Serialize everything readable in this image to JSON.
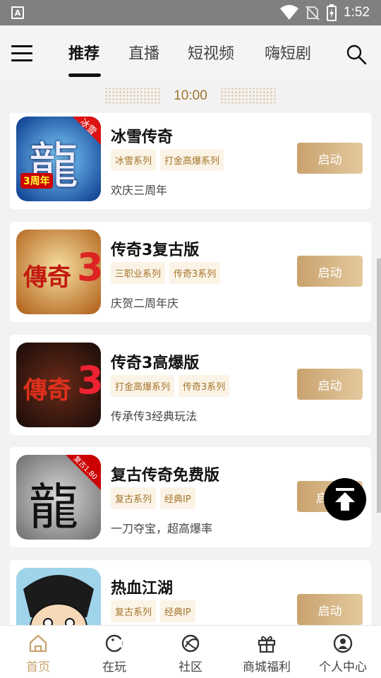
{
  "status_bar": {
    "time": "1:52",
    "app_badge": "A"
  },
  "nav": {
    "tabs": [
      {
        "label": "推荐",
        "active": true
      },
      {
        "label": "直播",
        "active": false
      },
      {
        "label": "短视频",
        "active": false
      },
      {
        "label": "嗨短剧",
        "active": false
      }
    ]
  },
  "countdown": {
    "time": "10:00"
  },
  "games": [
    {
      "title": "冰雪传奇",
      "tags": [
        "冰雪系列",
        "打金高爆系列"
      ],
      "desc": "欢庆三周年",
      "button": "启动",
      "thumb_text": "龍",
      "badge": "冰雪",
      "anniv": "3周年"
    },
    {
      "title": "传奇3复古版",
      "tags": [
        "三职业系列",
        "传奇3系列"
      ],
      "desc": "庆贺二周年庆",
      "button": "启动",
      "thumb_text": "傳奇",
      "thumb_num": "3"
    },
    {
      "title": "传奇3高爆版",
      "tags": [
        "打金高爆系列",
        "传奇3系列"
      ],
      "desc": "传承传3经典玩法",
      "button": "启动",
      "thumb_text": "傳奇",
      "thumb_num": "3"
    },
    {
      "title": "复古传奇免费版",
      "tags": [
        "复古系列",
        "经典IP"
      ],
      "desc": "一刀夺宝，超高爆率",
      "button": "启",
      "thumb_text": "龍",
      "badge": "复古1.80"
    },
    {
      "title": "热血江湖",
      "tags": [
        "复古系列",
        "经典IP"
      ],
      "desc": "",
      "button": "启动"
    }
  ],
  "bottom_nav": {
    "items": [
      {
        "label": "首页",
        "icon": "home-icon",
        "active": true
      },
      {
        "label": "在玩",
        "icon": "gamepad-icon",
        "active": false
      },
      {
        "label": "社区",
        "icon": "community-icon",
        "active": false
      },
      {
        "label": "商城福利",
        "icon": "gift-icon",
        "active": false
      },
      {
        "label": "个人中心",
        "icon": "profile-icon",
        "active": false
      }
    ]
  },
  "colors": {
    "accent": "#c9a26e",
    "tag_text": "#a3742a",
    "tag_bg": "#fbf3e6"
  }
}
